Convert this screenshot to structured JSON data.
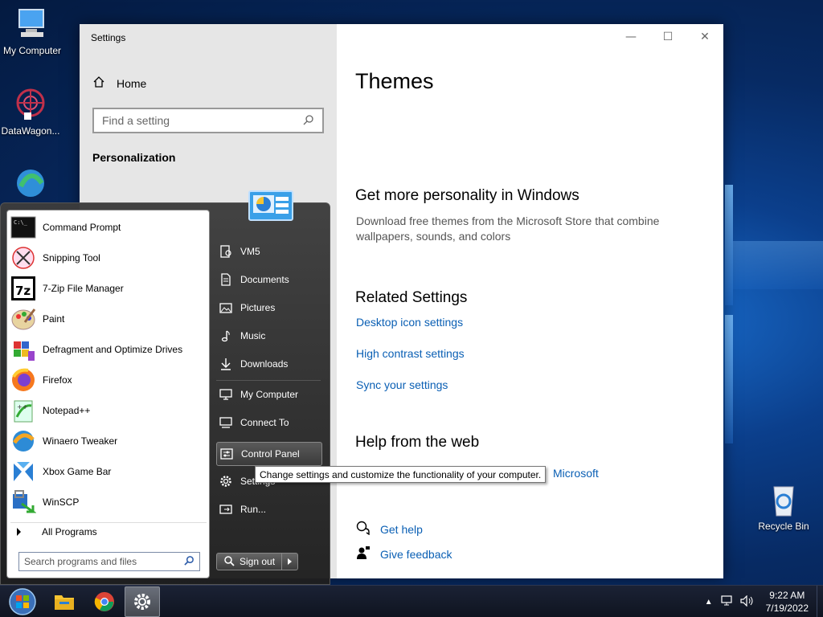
{
  "desktop": {
    "icons": [
      {
        "label": "My Computer",
        "icon": "monitor-icon"
      },
      {
        "label": "DataWagon...",
        "icon": "datawagon-icon"
      },
      {
        "label": "Recycle Bin",
        "icon": "recycle-bin-icon"
      }
    ]
  },
  "settings_window": {
    "title": "Settings",
    "controls": {
      "minimize": "—",
      "maximize": "☐",
      "close": "✕"
    },
    "sidebar": {
      "home_label": "Home",
      "search_placeholder": "Find a setting",
      "section_label": "Personalization"
    },
    "main": {
      "page_title": "Themes",
      "more_heading": "Get more personality in Windows",
      "more_desc": "Download free themes from the Microsoft Store that combine wallpapers, sounds, and colors",
      "related_heading": "Related Settings",
      "related_links": [
        "Desktop icon settings",
        "High contrast settings",
        "Sync your settings"
      ],
      "help_heading": "Help from the web",
      "help_partial_link": "Microsoft",
      "get_help": "Get help",
      "give_feedback": "Give feedback"
    }
  },
  "start_menu": {
    "programs": [
      {
        "label": "Command Prompt",
        "icon": "command-prompt-icon"
      },
      {
        "label": "Snipping Tool",
        "icon": "snipping-tool-icon"
      },
      {
        "label": "7-Zip File Manager",
        "icon": "7zip-icon"
      },
      {
        "label": "Paint",
        "icon": "paint-icon"
      },
      {
        "label": "Defragment and Optimize Drives",
        "icon": "defrag-icon"
      },
      {
        "label": "Firefox",
        "icon": "firefox-icon"
      },
      {
        "label": "Notepad++",
        "icon": "notepadpp-icon"
      },
      {
        "label": "Winaero Tweaker",
        "icon": "winaero-icon"
      },
      {
        "label": "Xbox Game Bar",
        "icon": "xbox-icon"
      },
      {
        "label": "WinSCP",
        "icon": "winscp-icon"
      }
    ],
    "all_programs": "All Programs",
    "search_placeholder": "Search programs and files",
    "right_items": [
      {
        "label": "VM5",
        "icon": "user-folder-icon"
      },
      {
        "label": "Documents",
        "icon": "documents-icon"
      },
      {
        "label": "Pictures",
        "icon": "pictures-icon"
      },
      {
        "label": "Music",
        "icon": "music-icon"
      },
      {
        "label": "Downloads",
        "icon": "downloads-icon"
      },
      {
        "label": "My Computer",
        "icon": "computer-icon"
      },
      {
        "label": "Connect To",
        "icon": "connect-icon"
      },
      {
        "label": "Control Panel",
        "icon": "control-panel-icon"
      },
      {
        "label": "Settings",
        "icon": "gear-icon"
      },
      {
        "label": "Run...",
        "icon": "run-icon"
      }
    ],
    "sign_out": "Sign out",
    "tooltip": "Change settings and customize the functionality of your computer."
  },
  "taskbar": {
    "pinned": [
      "start-orb-icon",
      "file-explorer-icon",
      "chrome-icon",
      "settings-gear-icon"
    ],
    "time": "9:22 AM",
    "date": "7/19/2022"
  }
}
